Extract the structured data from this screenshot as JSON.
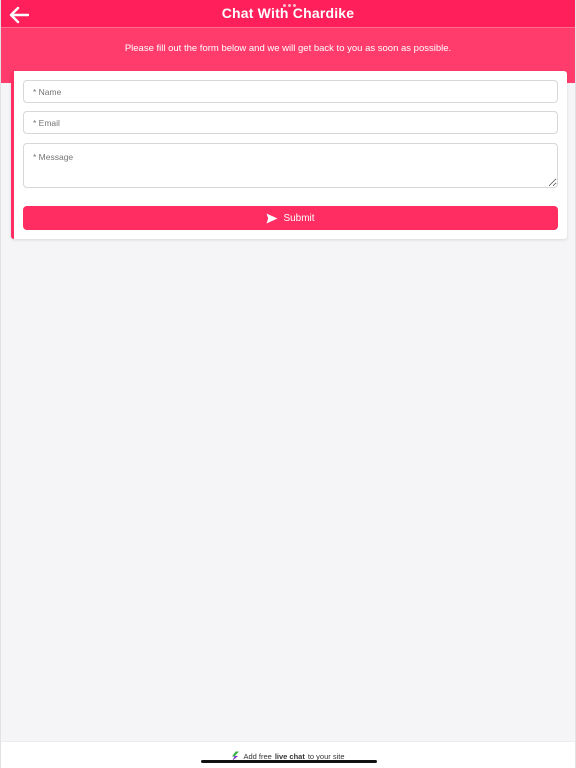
{
  "header": {
    "title": "Chat With Chardike",
    "back_icon": "arrow-left-icon",
    "background": "#ff1f5a"
  },
  "banner": {
    "intro": "Please fill out the form below and we will get back to you as soon as possible.",
    "background": "#ff3c6c"
  },
  "form": {
    "name_placeholder": "* Name",
    "email_placeholder": "* Email",
    "message_placeholder": "* Message",
    "submit_label": "Submit",
    "submit_icon": "send-icon",
    "accent": "#ff2d61"
  },
  "footer": {
    "prefix": "Add free",
    "highlight": "live chat",
    "suffix": "to your site",
    "icon": "brand-logo-icon"
  }
}
